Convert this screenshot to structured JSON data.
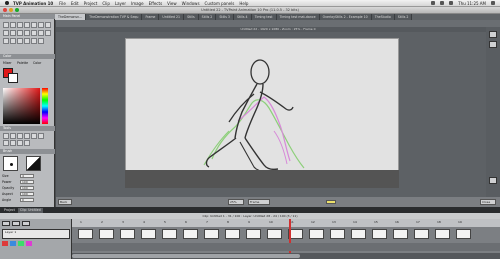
{
  "menubar": {
    "app_name": "TVP Animation 10",
    "items": [
      "File",
      "Edit",
      "Project",
      "Clip",
      "Layer",
      "Image",
      "Effects",
      "View",
      "Windows",
      "Custom panels",
      "Help"
    ],
    "clock": "Thu 11:25 AM"
  },
  "window": {
    "title": "Untitled 22 - TVPaint Animation 10 Pro (11.0.5 - 32 bits)"
  },
  "doc_tabs": [
    "TheDemonsn...",
    "TheDemonstration TVP & Sequ",
    "Frame",
    "Untitled 21",
    "Stills",
    "Stills 2",
    "Stills 3",
    "Stills 4",
    "Timing test",
    "Timing test mat-dance",
    "OverlayStills 2 - Example 10",
    "TheStudio",
    "Stills 2"
  ],
  "workspace": {
    "info": "Untitled 22 - 1920 x 1080 - Zoom : 25% - Frame 0",
    "status": "Untitled 22 - 1920 x 1080 - Layer: Untitled 28 - Frame : Untitled 28-3 - 31"
  },
  "left_panel": {
    "top_label": "Main Panel",
    "palette_label": "Color",
    "palette_tabs": [
      "Mixer",
      "Palette",
      "Color"
    ],
    "tools_label": "Tools",
    "brush_label": "Brush",
    "fields": [
      {
        "label": "Size",
        "value": "4"
      },
      {
        "label": "Power",
        "value": "100"
      },
      {
        "label": "Opacity",
        "value": "100"
      },
      {
        "label": "Aspect",
        "value": "100"
      },
      {
        "label": "Angle",
        "value": "0"
      }
    ]
  },
  "nav": {
    "back": "Back",
    "zoom": "25%",
    "frame_box": "Frame",
    "close": "Close"
  },
  "timeline": {
    "tabs": [
      "Project",
      "Clip: Untitled"
    ],
    "info": "Clip: Untitled 1 - 31 / 100 : Layer: Untitled 28 - 24 / 100 (3 / 11)",
    "layer_label": "Layer 1",
    "frame_numbers": [
      "1",
      "2",
      "3",
      "4",
      "5",
      "6",
      "7",
      "8",
      "9",
      "10",
      "11",
      "12",
      "13",
      "14",
      "15",
      "16",
      "17",
      "18",
      "19",
      "20"
    ]
  },
  "colors": {
    "accent": "#e01818",
    "canvas_bg": "#e2e2e2",
    "stroke": "#333333",
    "onion_green": "#8dcf7a",
    "onion_pink": "#d78ad8"
  }
}
